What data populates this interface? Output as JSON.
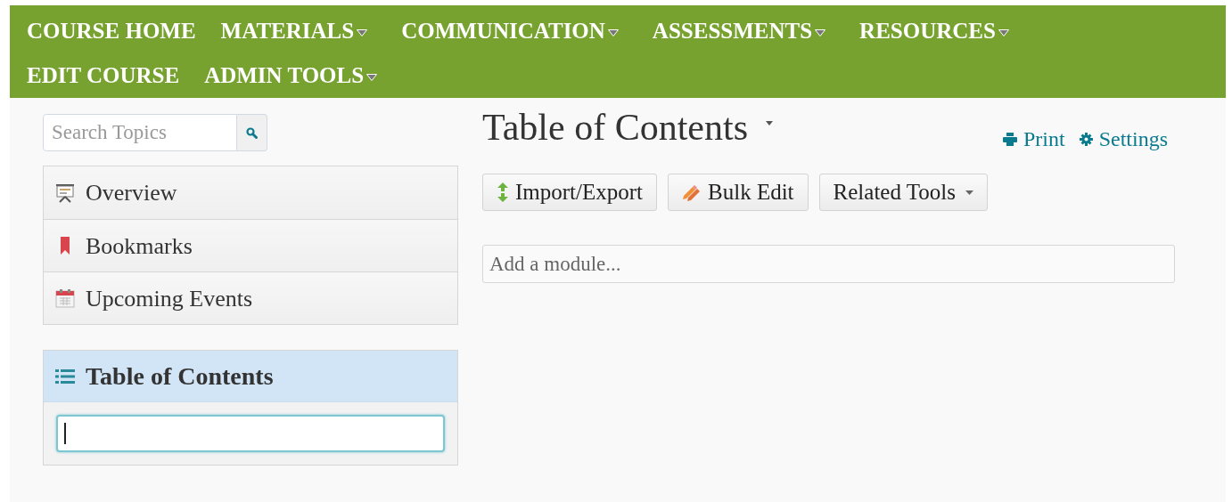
{
  "nav": [
    {
      "label": "COURSE HOME",
      "dropdown": false
    },
    {
      "label": "MATERIALS",
      "dropdown": true
    },
    {
      "label": "COMMUNICATION",
      "dropdown": true
    },
    {
      "label": "ASSESSMENTS",
      "dropdown": true
    },
    {
      "label": "RESOURCES",
      "dropdown": true
    },
    {
      "label": "EDIT COURSE",
      "dropdown": false
    },
    {
      "label": "ADMIN TOOLS",
      "dropdown": true
    }
  ],
  "sidebar": {
    "search": {
      "placeholder": "Search Topics"
    },
    "items": [
      {
        "label": "Overview",
        "kind": "overview"
      },
      {
        "label": "Bookmarks",
        "kind": "bookmarks"
      },
      {
        "label": "Upcoming Events",
        "kind": "events"
      }
    ],
    "toc": {
      "title": "Table of Contents",
      "field": {
        "focused": true
      }
    }
  },
  "main": {
    "title": "Table of Contents",
    "links": [
      {
        "label": "Print",
        "kind": "print"
      },
      {
        "label": "Settings",
        "kind": "settings"
      }
    ],
    "buttons": [
      {
        "label": "Import/Export",
        "kind": "import"
      },
      {
        "label": "Bulk Edit",
        "kind": "edit"
      },
      {
        "label": "Related Tools",
        "kind": "menu"
      }
    ],
    "module_field": {
      "placeholder": "Add a module..."
    }
  }
}
